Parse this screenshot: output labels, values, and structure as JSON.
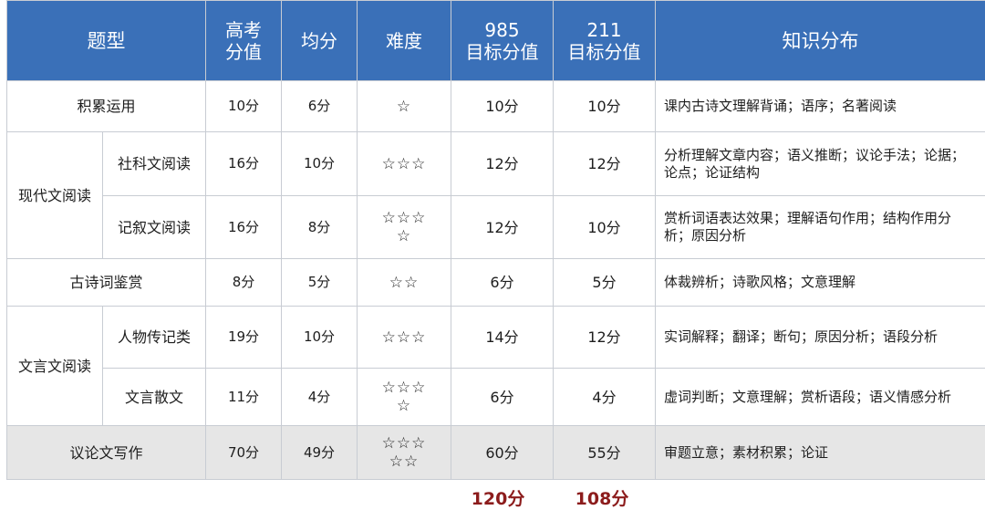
{
  "header": {
    "type": "题型",
    "gaokao": "高考\n分值",
    "average": "均分",
    "difficulty": "难度",
    "target985": "985\n目标分值",
    "target211": "211\n目标分值",
    "knowledge": "知识分布"
  },
  "rows": {
    "accumulate": {
      "name": "积累运用",
      "score": "10分",
      "avg": "6分",
      "stars": "☆",
      "t985": "10分",
      "t211": "10分",
      "knowledge": "课内古诗文理解背诵；语序；名著阅读"
    },
    "modern_group": "现代文阅读",
    "social": {
      "name": "社科文阅读",
      "score": "16分",
      "avg": "10分",
      "stars": "☆☆☆",
      "t985": "12分",
      "t211": "12分",
      "knowledge": "分析理解文章内容；语义推断；议论手法；论据；论点；论证结构"
    },
    "narrative": {
      "name": "记叙文阅读",
      "score": "16分",
      "avg": "8分",
      "stars": "☆☆☆☆",
      "t985": "12分",
      "t211": "10分",
      "knowledge": "赏析词语表达效果；理解语句作用；结构作用分析；原因分析"
    },
    "poem": {
      "name": "古诗词鉴赏",
      "score": "8分",
      "avg": "5分",
      "stars": "☆☆",
      "t985": "6分",
      "t211": "5分",
      "knowledge": "体裁辨析；诗歌风格；文意理解"
    },
    "classical_group": "文言文阅读",
    "biography": {
      "name": "人物传记类",
      "score": "19分",
      "avg": "10分",
      "stars": "☆☆☆",
      "t985": "14分",
      "t211": "12分",
      "knowledge": "实词解释；翻译；断句；原因分析；语段分析"
    },
    "prose": {
      "name": "文言散文",
      "score": "11分",
      "avg": "4分",
      "stars": "☆☆☆☆",
      "t985": "6分",
      "t211": "4分",
      "knowledge": "虚词判断；文意理解；赏析语段；语义情感分析"
    },
    "essay": {
      "name": "议论文写作",
      "score": "70分",
      "avg": "49分",
      "stars": "☆☆☆☆☆",
      "t985": "60分",
      "t211": "55分",
      "knowledge": "审题立意；素材积累；论证"
    }
  },
  "totals": {
    "t985": "120分",
    "t211": "108分"
  },
  "colors": {
    "header_bg": "#3a70b8",
    "header_text": "#ffffff",
    "essay_row_bg": "#e6e6e6",
    "total_text": "#8c1c1c",
    "grid": "#c8ccd3"
  }
}
